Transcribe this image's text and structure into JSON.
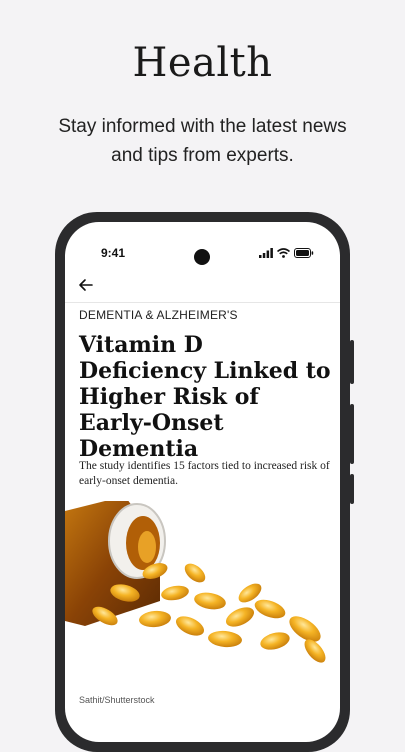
{
  "hero": {
    "title": "Health",
    "subtitle": "Stay informed with the latest news and tips from experts."
  },
  "status_bar": {
    "time": "9:41",
    "icons": [
      "signal-icon",
      "wifi-icon",
      "battery-icon"
    ]
  },
  "nav": {
    "back_icon": "arrow-left-icon"
  },
  "article": {
    "category": "DEMENTIA & ALZHEIMER'S",
    "headline": "Vitamin D Deficiency Linked to Higher Risk of Early-Onset Dementia",
    "summary": "The study identifies 15 factors tied to increased risk of early-onset dementia.",
    "image_credit": "Sathit/Shutterstock"
  },
  "colors": {
    "background": "#f4f3f5",
    "phone_frame": "#2b2b2d",
    "capsule": "#f0b020"
  }
}
